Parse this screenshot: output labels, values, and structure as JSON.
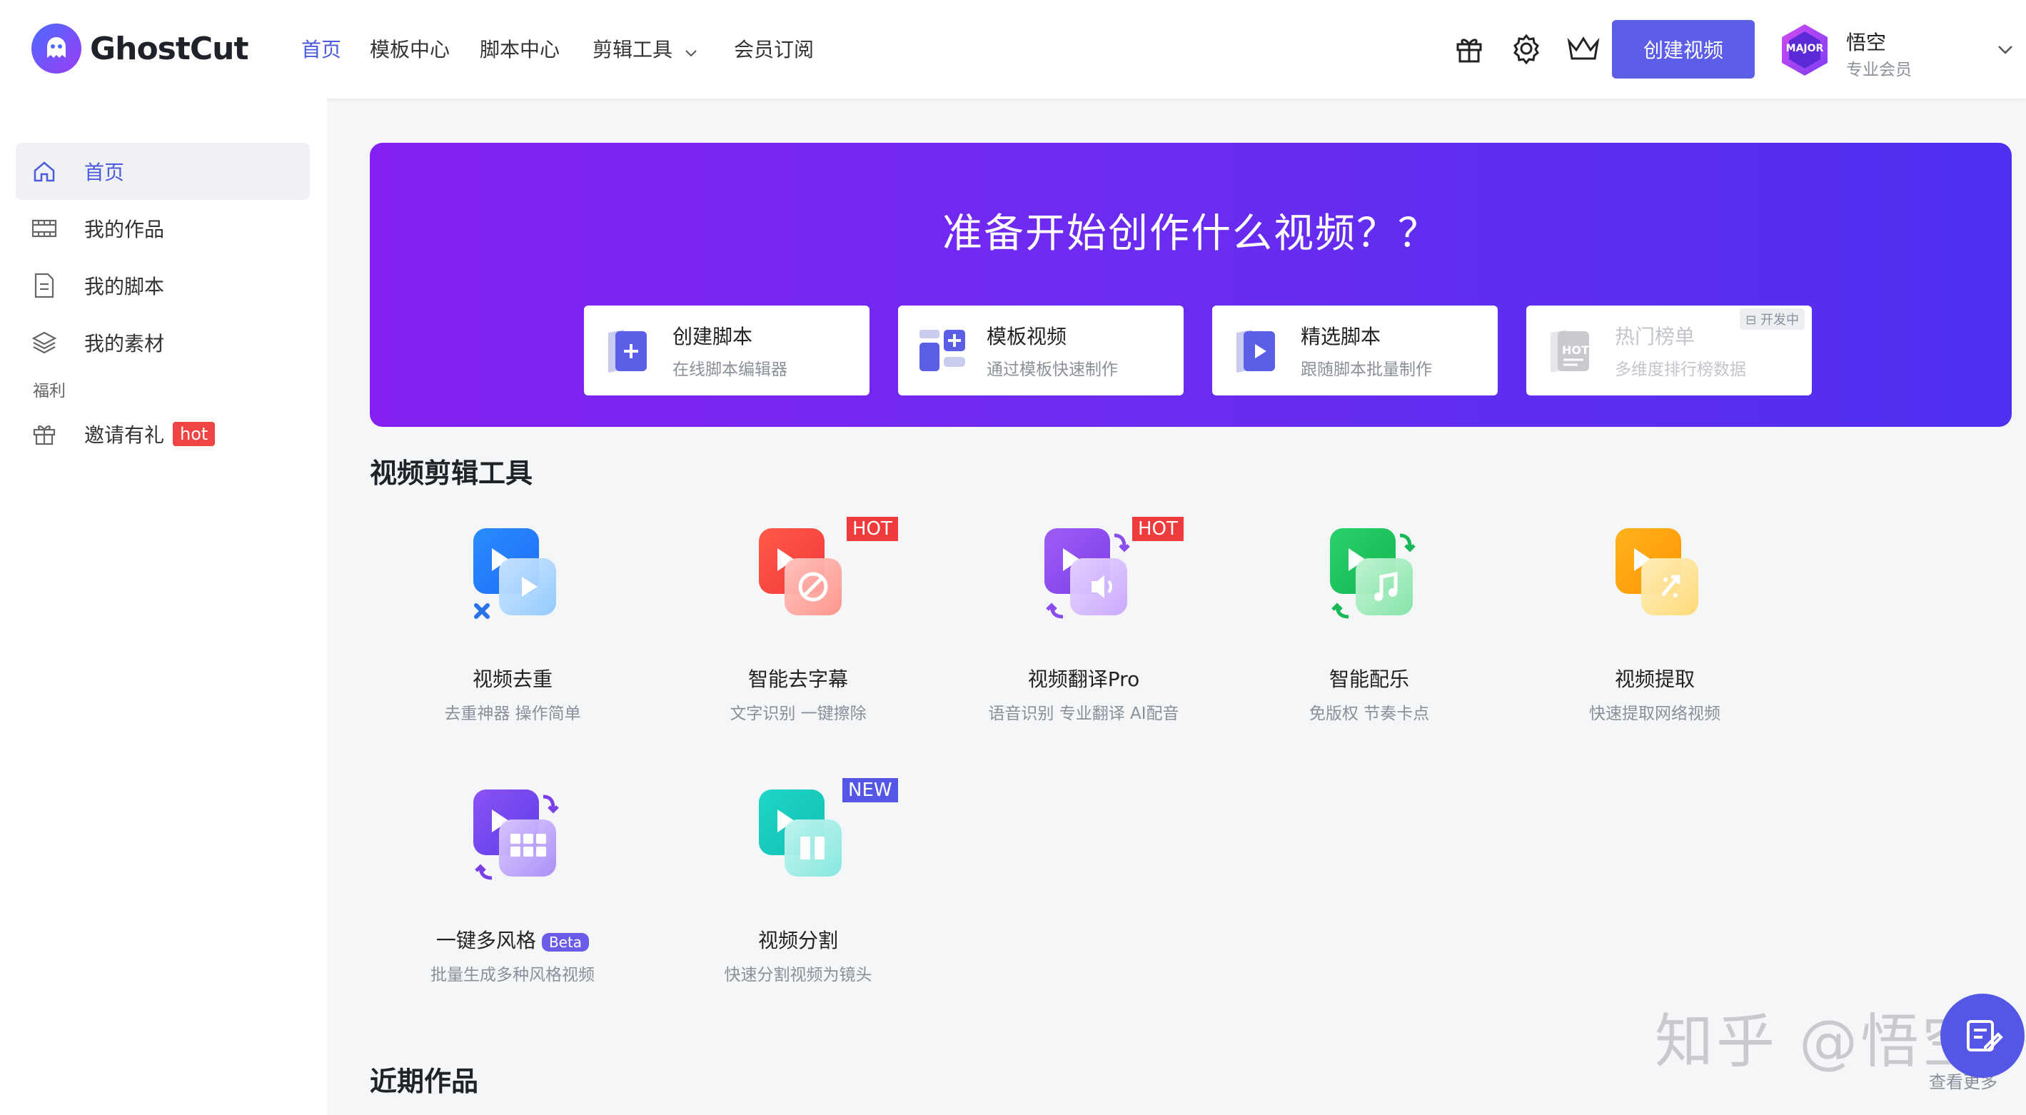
{
  "header": {
    "brand": "GhostCut",
    "nav": [
      {
        "label": "首页",
        "active": true
      },
      {
        "label": "模板中心",
        "active": false
      },
      {
        "label": "脚本中心",
        "active": false
      },
      {
        "label": "剪辑工具",
        "active": false,
        "has_dropdown": true
      },
      {
        "label": "会员订阅",
        "active": false
      }
    ],
    "icons": [
      "gift-icon",
      "gear-icon",
      "crown-icon"
    ],
    "create_button": "创建视频",
    "user": {
      "avatar_badge": "MAJOR",
      "name": "悟空",
      "tier": "专业会员"
    }
  },
  "sidebar": {
    "items": [
      {
        "label": "首页",
        "icon": "home-icon",
        "active": true
      },
      {
        "label": "我的作品",
        "icon": "film-icon",
        "active": false
      },
      {
        "label": "我的脚本",
        "icon": "document-icon",
        "active": false
      },
      {
        "label": "我的素材",
        "icon": "layers-icon",
        "active": false
      }
    ],
    "group_label": "福利",
    "invite": {
      "label": "邀请有礼",
      "badge": "hot",
      "icon": "gift-icon"
    }
  },
  "banner": {
    "title": "准备开始创作什么视频？？",
    "cards": [
      {
        "title": "创建脚本",
        "subtitle": "在线脚本编辑器",
        "icon": "add-document-icon",
        "disabled": false
      },
      {
        "title": "模板视频",
        "subtitle": "通过模板快速制作",
        "icon": "template-grid-icon",
        "disabled": false
      },
      {
        "title": "精选脚本",
        "subtitle": "跟随脚本批量制作",
        "icon": "play-document-icon",
        "disabled": false
      },
      {
        "title": "热门榜单",
        "subtitle": "多维度排行榜数据",
        "icon": "hot-list-icon",
        "disabled": true,
        "tag": "开发中"
      }
    ]
  },
  "tools_section": {
    "title": "视频剪辑工具",
    "tools": [
      {
        "name": "视频去重",
        "desc": "去重神器 操作简单",
        "icon": "dedupe-icon",
        "tag": ""
      },
      {
        "name": "智能去字幕",
        "desc": "文字识别 一键擦除",
        "icon": "remove-subtitle-icon",
        "tag": "HOT"
      },
      {
        "name": "视频翻译Pro",
        "desc": "语音识别 专业翻译 AI配音",
        "icon": "translate-icon",
        "tag": "HOT"
      },
      {
        "name": "智能配乐",
        "desc": "免版权 节奏卡点",
        "icon": "music-icon",
        "tag": ""
      },
      {
        "name": "视频提取",
        "desc": "快速提取网络视频",
        "icon": "extract-icon",
        "tag": ""
      },
      {
        "name": "一键多风格",
        "desc": "批量生成多种风格视频",
        "icon": "multi-style-icon",
        "tag": "",
        "badge": "Beta"
      },
      {
        "name": "视频分割",
        "desc": "快速分割视频为镜头",
        "icon": "split-icon",
        "tag": "NEW"
      }
    ]
  },
  "recent_section": {
    "title": "近期作品",
    "see_more": "查看更多"
  },
  "watermark": "知乎 @悟空"
}
